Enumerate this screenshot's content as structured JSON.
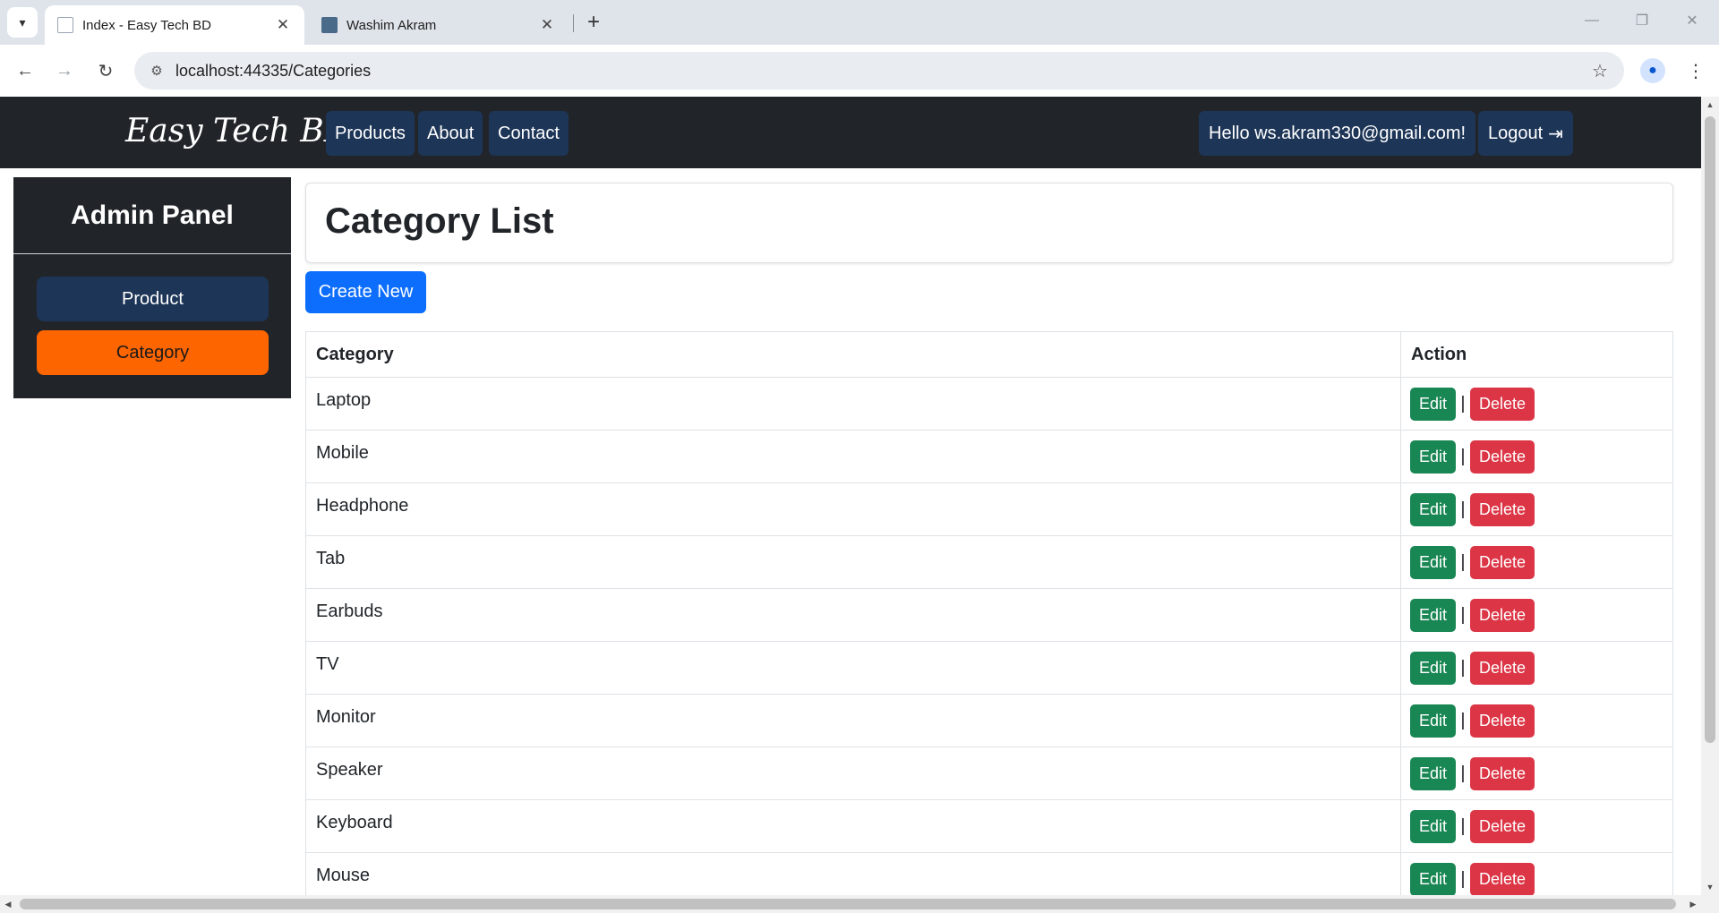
{
  "browser": {
    "tabs": [
      {
        "title": "Index - Easy Tech BD",
        "active": true
      },
      {
        "title": "Washim Akram",
        "active": false
      }
    ],
    "new_tab_glyph": "+",
    "close_glyph": "✕",
    "url": "localhost:44335/Categories",
    "icons": {
      "tab_search": "▾",
      "back": "←",
      "forward": "→",
      "reload": "↻",
      "site_info": "⚙",
      "bookmark": "☆",
      "profile": "●",
      "menu": "⋮",
      "minimize": "—",
      "restore": "❐",
      "close_window": "✕"
    }
  },
  "navbar": {
    "brand": "Easy Tech BD",
    "links": [
      "Products",
      "About",
      "Contact"
    ],
    "greeting": "Hello ws.akram330@gmail.com!",
    "logout": "Logout",
    "logout_icon": "⇥"
  },
  "sidebar": {
    "title": "Admin Panel",
    "items": [
      "Product",
      "Category"
    ]
  },
  "main": {
    "title": "Category List",
    "create_button": "Create New",
    "table": {
      "headers": [
        "Category",
        "Action"
      ],
      "rows": [
        "Laptop",
        "Mobile",
        "Headphone",
        "Tab",
        "Earbuds",
        "TV",
        "Monitor",
        "Speaker",
        "Keyboard",
        "Mouse"
      ],
      "edit_label": "Edit",
      "delete_label": "Delete",
      "separator": "|"
    }
  },
  "colors": {
    "navbar_bg": "#212529",
    "nav_button": "#1d3557",
    "active_sidebar": "#fd6500",
    "primary": "#0d6efd",
    "edit": "#198754",
    "delete": "#dc3545"
  }
}
